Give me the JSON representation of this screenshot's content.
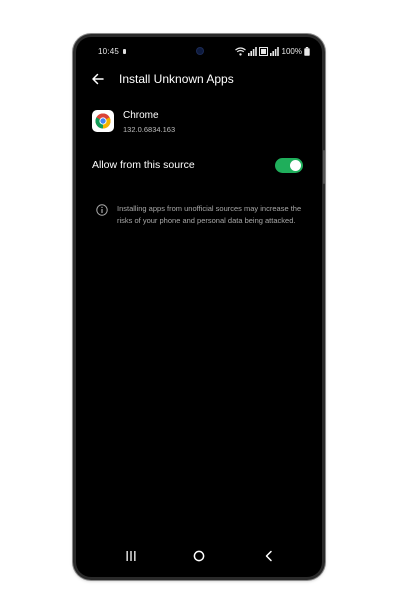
{
  "status_bar": {
    "time": "10:45",
    "battery_percent": "100%"
  },
  "app_bar": {
    "title": "Install Unknown Apps"
  },
  "app": {
    "name": "Chrome",
    "version": "132.0.6834.163",
    "icon": "chrome-icon"
  },
  "setting": {
    "label": "Allow from this source",
    "enabled": true,
    "accent_color": "#1fae5b"
  },
  "info": {
    "text": "Installing apps from unofficial sources may increase the risks of your phone and personal data being attacked."
  },
  "nav_bar": {
    "recents_icon": "recents-icon",
    "home_icon": "home-icon",
    "back_icon": "back-icon"
  }
}
